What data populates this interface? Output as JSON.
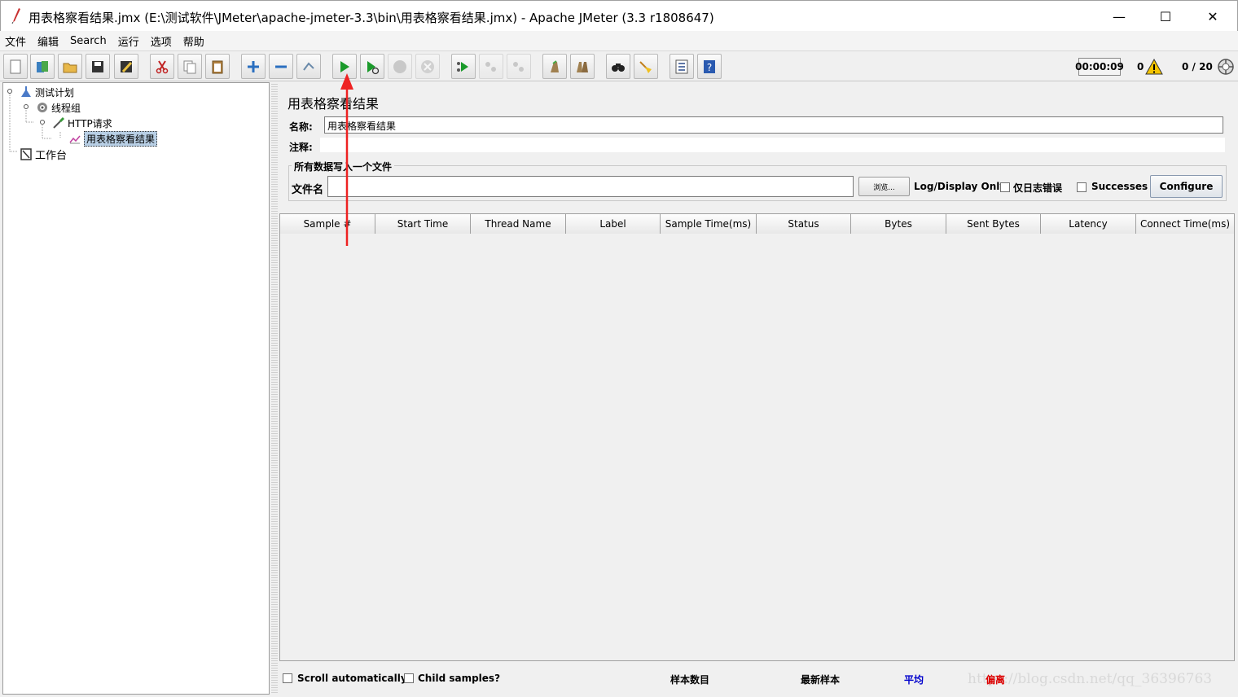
{
  "window": {
    "title": "用表格察看结果.jmx (E:\\测试软件\\JMeter\\apache-jmeter-3.3\\bin\\用表格察看结果.jmx) - Apache JMeter (3.3 r1808647)",
    "minimize": "—",
    "maximize": "☐",
    "close": "✕"
  },
  "menu": [
    "文件",
    "编辑",
    "Search",
    "运行",
    "选项",
    "帮助"
  ],
  "toolbar": {
    "icons": [
      "new-icon",
      "templates-icon",
      "open-icon",
      "save-icon",
      "save-as-icon",
      "cut-icon",
      "copy-icon",
      "paste-icon",
      "expand-icon",
      "collapse-icon",
      "toggle-icon",
      "start-icon",
      "start-no-pause-icon",
      "stop-icon",
      "shutdown-icon",
      "remote-start-icon",
      "remote-stop-icon",
      "remote-shutdown-icon",
      "clear-icon",
      "clear-all-icon",
      "search-icon",
      "reset-search-icon",
      "function-helper-icon",
      "help-icon"
    ],
    "timer": "00:00:09",
    "error_count": "0",
    "threads": "0 / 20"
  },
  "tree": {
    "items": [
      {
        "label": "测试计划",
        "icon": "test-plan-icon"
      },
      {
        "label": "线程组",
        "icon": "gear-icon"
      },
      {
        "label": "HTTP请求",
        "icon": "pipette-icon"
      },
      {
        "label": "用表格察看结果",
        "icon": "chart-icon"
      },
      {
        "label": "工作台",
        "icon": "workbench-icon"
      }
    ]
  },
  "panel": {
    "title": "用表格察看结果",
    "name_label": "名称:",
    "name_value": "用表格察看结果",
    "comment_label": "注释:",
    "group_title": "所有数据写入一个文件",
    "file_label": "文件名",
    "browse": "浏览...",
    "log_display_only": "Log/Display Only:",
    "errors_only": "仅日志错误",
    "successes": "Successes",
    "configure": "Configure"
  },
  "table": {
    "columns": [
      "Sample #",
      "Start Time",
      "Thread Name",
      "Label",
      "Sample Time(ms)",
      "Status",
      "Bytes",
      "Sent Bytes",
      "Latency",
      "Connect Time(ms)"
    ]
  },
  "bottom": {
    "scroll_auto": "Scroll automatically?",
    "child_samples": "Child samples?",
    "sample_count": "样本数目",
    "latest_sample": "最新样本",
    "average": "平均",
    "deviation": "偏离",
    "average_color": "#0000cc",
    "deviation_color": "#dd0000"
  },
  "watermark": "https://blog.csdn.net/qq_36396763"
}
